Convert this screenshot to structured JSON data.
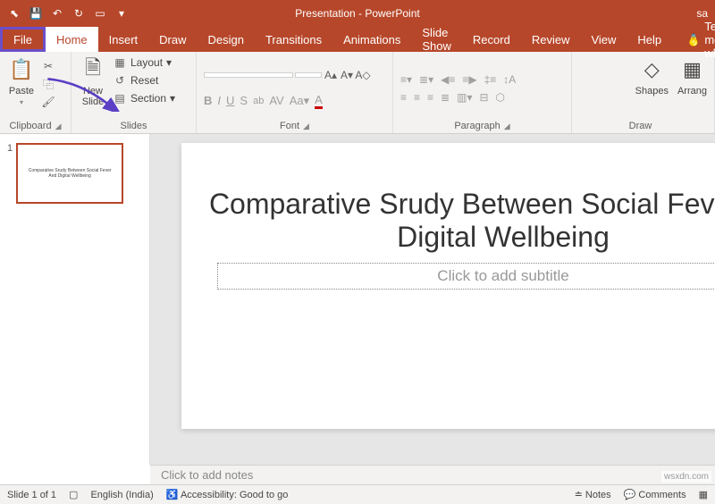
{
  "titlebar": {
    "title": "Presentation - PowerPoint",
    "user": "sa"
  },
  "tabs": {
    "file": "File",
    "home": "Home",
    "insert": "Insert",
    "draw": "Draw",
    "design": "Design",
    "transitions": "Transitions",
    "animations": "Animations",
    "slideshow": "Slide Show",
    "record": "Record",
    "review": "Review",
    "view": "View",
    "help": "Help",
    "tell": "Tell me what"
  },
  "ribbon": {
    "clipboard": {
      "label": "Clipboard",
      "paste": "Paste"
    },
    "slides": {
      "label": "Slides",
      "newslide": "New\nSlide",
      "layout": "Layout",
      "reset": "Reset",
      "section": "Section"
    },
    "font": {
      "label": "Font"
    },
    "paragraph": {
      "label": "Paragraph"
    },
    "drawing": {
      "label": "Draw",
      "shapes": "Shapes",
      "arrange": "Arrang"
    }
  },
  "slide": {
    "title": "Comparative Srudy Between Social Fever And Digital Wellbeing",
    "subtitle_placeholder": "Click to add subtitle",
    "thumb_title": "Comparative Srudy Between Social Fever And Digital Wellbeing"
  },
  "notes": {
    "placeholder": "Click to add notes"
  },
  "status": {
    "slide": "Slide 1 of 1",
    "lang": "English (India)",
    "accessibility": "Accessibility: Good to go",
    "notes": "Notes",
    "comments": "Comments"
  },
  "watermark": "wsxdn.com",
  "thumb_num": "1"
}
